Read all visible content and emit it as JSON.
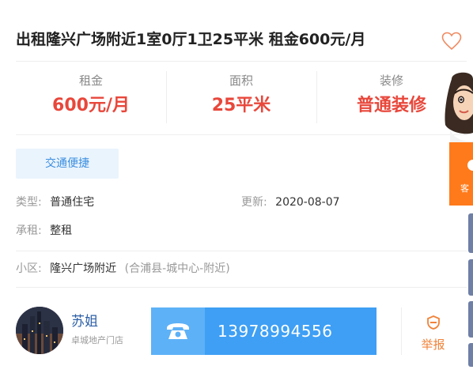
{
  "listing": {
    "title": "出租隆兴广场附近1室0厅1卫25平米 租金600元/月"
  },
  "stats": [
    {
      "label": "租金",
      "value": "600元/月"
    },
    {
      "label": "面积",
      "value": "25平米"
    },
    {
      "label": "装修",
      "value": "普通装修"
    }
  ],
  "tags": [
    "交通便捷"
  ],
  "info": {
    "type_label": "类型:",
    "type_value": "普通住宅",
    "updated_label": "更新:",
    "updated_value": "2020-08-07",
    "rent_label": "承租:",
    "rent_value": "整租",
    "community_label": "小区:",
    "community_value": "隆兴广场附近",
    "community_sub": "(合浦县-城中心-附近)"
  },
  "agent": {
    "name": "苏姐",
    "store": "卓城地产门店"
  },
  "contact": {
    "phone": "13978994556"
  },
  "report": {
    "label": "举报"
  },
  "side": {
    "service_text": "客"
  },
  "colors": {
    "accent_red": "#e8473b",
    "phone_blue": "#3e9ff5",
    "report_orange": "#f0833a",
    "tag_blue": "#3b8ee0"
  }
}
